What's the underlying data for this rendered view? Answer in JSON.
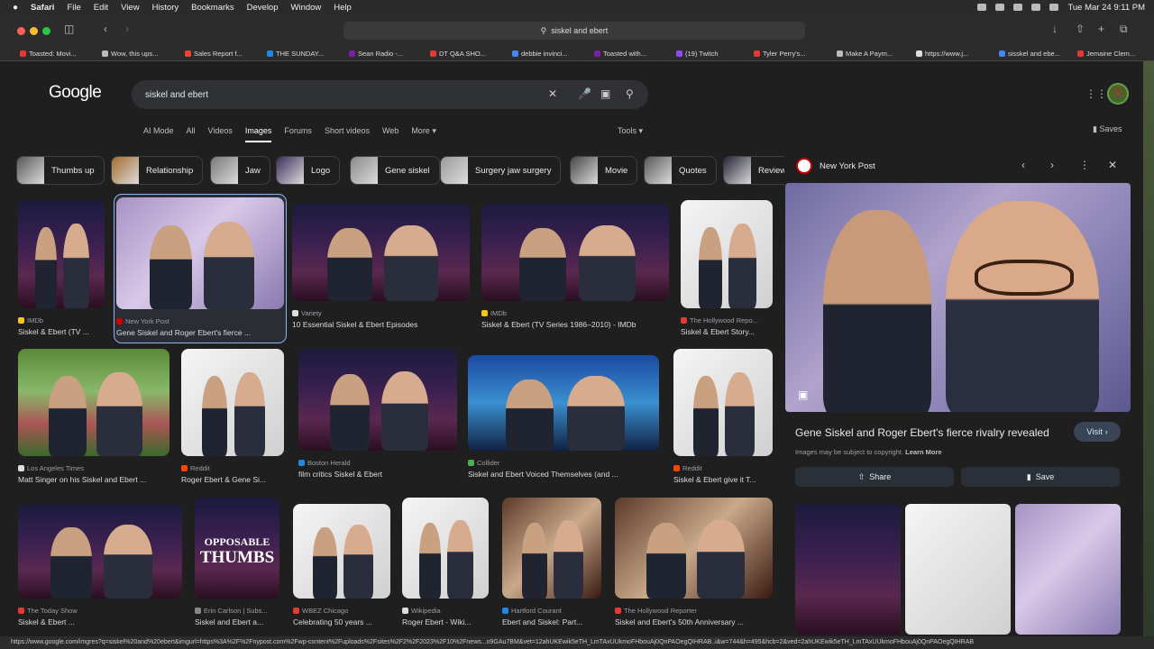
{
  "menubar": {
    "app": "Safari",
    "items": [
      "File",
      "Edit",
      "View",
      "History",
      "Bookmarks",
      "Develop",
      "Window",
      "Help"
    ],
    "clock": "Tue Mar 24  9:11 PM"
  },
  "toolbar": {
    "url": "sisskel and ebert"
  },
  "bookmarks": [
    {
      "label": "Toasted: Movi...",
      "color": "#e53935"
    },
    {
      "label": "Wow, this ups...",
      "color": "#bbb"
    },
    {
      "label": "Sales Report f...",
      "color": "#ea4335"
    },
    {
      "label": "THE SUNDAY...",
      "color": "#1e88e5"
    },
    {
      "label": "Sean Radio -...",
      "color": "#7b1fa2"
    },
    {
      "label": "DT Q&A SHO...",
      "color": "#e53935"
    },
    {
      "label": "debbie invinci...",
      "color": "#4285f4"
    },
    {
      "label": "Toasted with...",
      "color": "#7b1fa2"
    },
    {
      "label": "(19) Twitch",
      "color": "#9146ff"
    },
    {
      "label": "Tyler Perry's...",
      "color": "#e53935"
    },
    {
      "label": "Make A Paym...",
      "color": "#bbb"
    },
    {
      "label": "https://www.j...",
      "color": "#ddd"
    },
    {
      "label": "sisskel and ebe...",
      "color": "#4285f4"
    },
    {
      "label": "Jemaine Clem...",
      "color": "#e53935"
    }
  ],
  "google": {
    "logo": "Google",
    "query": "siskel and ebert",
    "tabs": [
      "AI Mode",
      "All",
      "Videos",
      "Images",
      "Forums",
      "Short videos",
      "Web",
      "More"
    ],
    "active_tab": "Images",
    "tools": "Tools",
    "saves": "Saves"
  },
  "chips": [
    "Thumbs up",
    "Relationship",
    "Jaw",
    "Logo",
    "Gene siskel",
    "Surgery jaw surgery",
    "Movie",
    "Quotes",
    "Review"
  ],
  "results": [
    {
      "source": "IMDb",
      "title": "Siskel & Ebert (TV ...",
      "style": "stage",
      "fav": "#f5c518"
    },
    {
      "source": "New York Post",
      "title": "Gene Siskel and Roger Ebert's fierce ...",
      "style": "purple",
      "fav": "#c00"
    },
    {
      "source": "Variety",
      "title": "10 Essential Siskel & Ebert Episodes",
      "style": "stage",
      "fav": "#ddd"
    },
    {
      "source": "IMDb",
      "title": "Siskel & Ebert (TV Series 1986–2010) - IMDb",
      "style": "stage",
      "fav": "#f5c518"
    },
    {
      "source": "The Hollywood Repo...",
      "title": "Siskel & Ebert Story...",
      "style": "bw",
      "fav": "#e53935"
    },
    {
      "source": "Los Angeles Times",
      "title": "Matt Singer on his Siskel and Ebert ...",
      "style": "green",
      "fav": "#ddd"
    },
    {
      "source": "Reddit",
      "title": "Roger Ebert & Gene Si...",
      "style": "bw",
      "fav": "#ff4500"
    },
    {
      "source": "Boston Herald",
      "title": "film critics Siskel & Ebert",
      "style": "stage",
      "fav": "#1e88e5"
    },
    {
      "source": "Collider",
      "title": "Siskel and Ebert Voiced Themselves (and ...",
      "style": "cartoon",
      "fav": "#4caf50"
    },
    {
      "source": "Reddit",
      "title": "Siskel & Ebert give it T...",
      "style": "bw",
      "fav": "#ff4500"
    },
    {
      "source": "The Today Show",
      "title": "Siskel & Ebert ...",
      "style": "stage",
      "fav": "#e53935"
    },
    {
      "source": "Erin Carlson | Subs...",
      "title": "Siskel and Ebert a...",
      "style": "stage",
      "fav": "#888"
    },
    {
      "source": "WBEZ Chicago",
      "title": "Celebrating 50 years ...",
      "style": "bw",
      "fav": "#e53935"
    },
    {
      "source": "Wikipedia",
      "title": "Roger Ebert - Wiki...",
      "style": "bw",
      "fav": "#ddd"
    },
    {
      "source": "Hartford Courant",
      "title": "Ebert and Siskel: Part...",
      "style": "brown",
      "fav": "#1e88e5"
    },
    {
      "source": "The Hollywood Reporter",
      "title": "Siskel and Ebert's 50th Anniversary ...",
      "style": "brown",
      "fav": "#e53935"
    }
  ],
  "opposable": {
    "line1": "OPPOSABLE",
    "line2": "THUMBS"
  },
  "panel": {
    "source": "New York Post",
    "title": "Gene Siskel and Roger Ebert's fierce rivalry revealed",
    "visit": "Visit",
    "copyright": "Images may be subject to copyright.",
    "learn_more": "Learn More",
    "share": "Share",
    "save": "Save"
  },
  "status_url": "https://www.google.com/imgres?q=siskel%20and%20ebert&imgurl=https%3A%2F%2Fnypost.com%2Fwp-content%2Fuploads%2Fsites%2F2%2F2023%2F10%2Fnews...o9GAu7BM&vet=12ahUKEwik5eTH_LmTAxUUkmoFHbouAj0QnPAOegQIHRAB..i&w=744&h=495&hcb=2&ved=2ahUKEwik5eTH_LmTAxUUkmoFHbouAj0QnPAOegQIHRAB"
}
